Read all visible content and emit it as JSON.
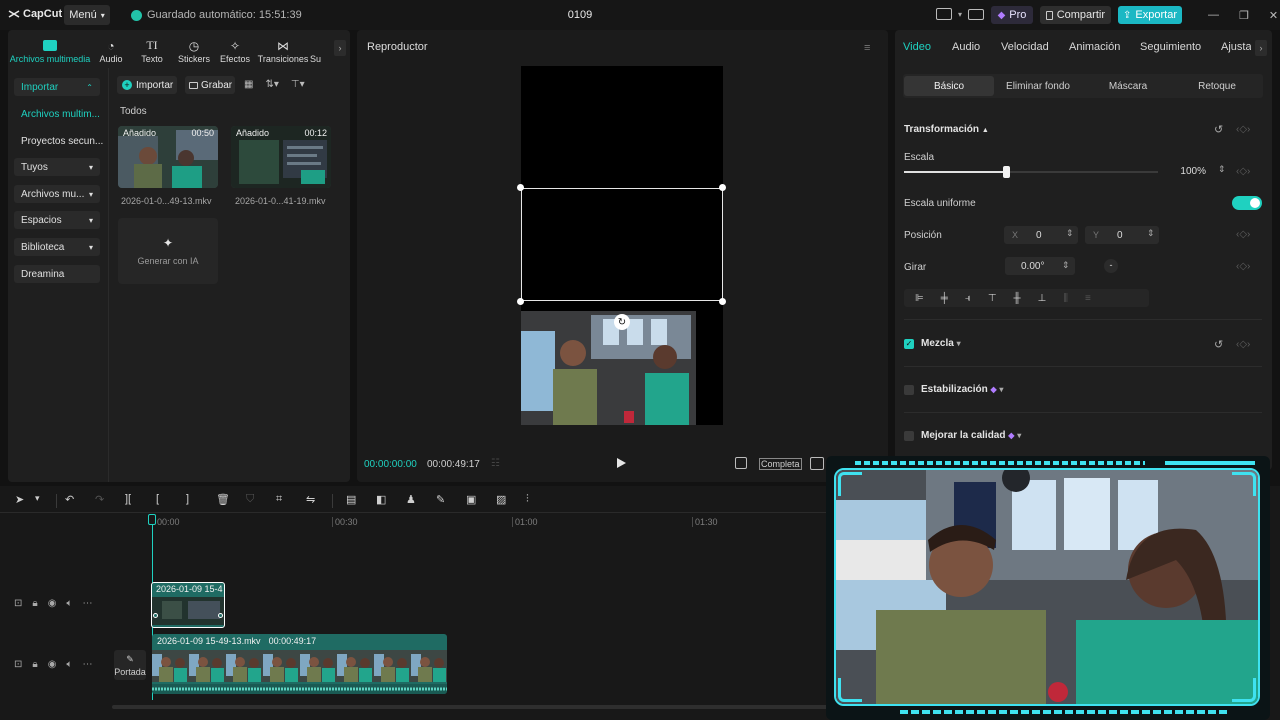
{
  "topbar": {
    "logo": "CapCut",
    "menu": "Menú",
    "autosave": "Guardado automático: 15:51:39",
    "title": "0109",
    "pro": "Pro",
    "share": "Compartir",
    "export": "Exportar"
  },
  "media_tabs": [
    {
      "label": "Archivos multimedia",
      "icon": "media-icon"
    },
    {
      "label": "Audio",
      "icon": "audio-icon"
    },
    {
      "label": "Texto",
      "icon": "text-icon"
    },
    {
      "label": "Stickers",
      "icon": "sticker-icon"
    },
    {
      "label": "Efectos",
      "icon": "effects-icon"
    },
    {
      "label": "Transiciones",
      "icon": "transitions-icon"
    },
    {
      "label": "Su",
      "icon": "subtitles-icon"
    }
  ],
  "sidebar": {
    "importar": "Importar",
    "archivos": "Archivos multim...",
    "proyectos": "Proyectos secun...",
    "tuyos": "Tuyos",
    "archivos_mu": "Archivos mu...",
    "espacios": "Espacios",
    "biblioteca": "Biblioteca",
    "dreamina": "Dreamina"
  },
  "media_toolbar": {
    "import": "Importar",
    "record": "Grabar",
    "filter_all": "Todos"
  },
  "media_items": [
    {
      "badge": "Añadido",
      "duration": "00:50",
      "name": "2026-01-0...49-13.mkv"
    },
    {
      "badge": "Añadido",
      "duration": "00:12",
      "name": "2026-01-0...41-19.mkv"
    }
  ],
  "ai_generate": "Generar con IA",
  "player": {
    "title": "Reproductor",
    "current_time": "00:00:00:00",
    "total_time": "00:00:49:17",
    "ratio_label": "Completa"
  },
  "right_tabs": [
    "Video",
    "Audio",
    "Velocidad",
    "Animación",
    "Seguimiento",
    "Ajusta"
  ],
  "right_subtabs": [
    "Básico",
    "Eliminar fondo",
    "Máscara",
    "Retoque"
  ],
  "props": {
    "transform": "Transformación",
    "scale": "Escala",
    "scale_value": "100%",
    "scale_fraction": 0.4,
    "uniform_scale": "Escala uniforme",
    "position": "Posición",
    "pos_x_label": "X",
    "pos_x": "0",
    "pos_y_label": "Y",
    "pos_y": "0",
    "rotate": "Girar",
    "rotate_value": "0.00°",
    "blend": "Mezcla",
    "stabilization": "Estabilización",
    "enhance": "Mejorar la calidad"
  },
  "timeline": {
    "ticks": [
      "00:00",
      "00:30",
      "01:00",
      "01:30"
    ],
    "clip_top": "2026-01-09 15-4",
    "clip_main_name": "2026-01-09 15-49-13.mkv",
    "clip_main_duration": "00:00:49:17",
    "cover": "Portada"
  },
  "colors": {
    "accent": "#1fd1c0",
    "export_bg": "#1bb8c4",
    "clip_green": "#1f6b63",
    "panel": "#1f1f1f"
  }
}
